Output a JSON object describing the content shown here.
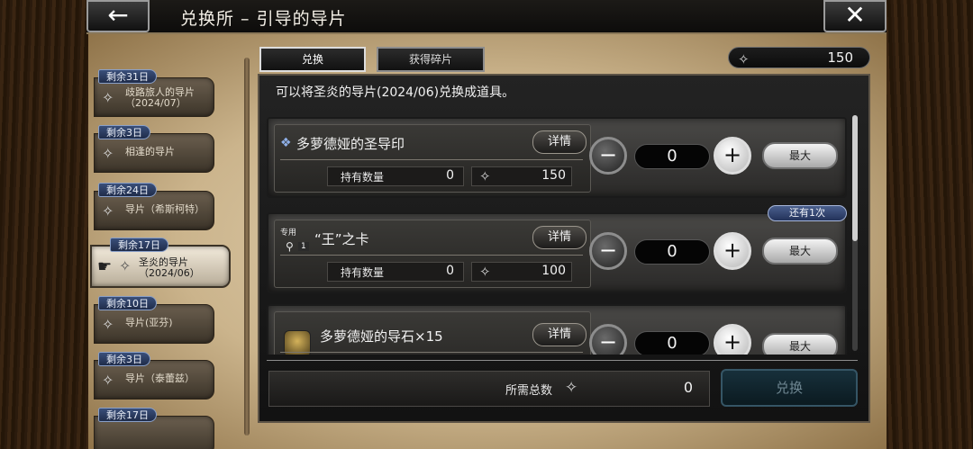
{
  "header": {
    "title": "兑换所 – 引导的导片",
    "back_icon": "←",
    "close_icon": "✕"
  },
  "sidebar": {
    "items": [
      {
        "badge": "剩余31日",
        "label": "歧路旅人的导片（2024/07）",
        "active": false
      },
      {
        "badge": "剩余3日",
        "label": "相逢的导片",
        "active": false
      },
      {
        "badge": "剩余24日",
        "label": "导片（希斯柯特）",
        "active": false
      },
      {
        "badge": "剩余17日",
        "label": "圣炎的导片（2024/06）",
        "active": true
      },
      {
        "badge": "剩余10日",
        "label": "导片(亚芬)",
        "active": false
      },
      {
        "badge": "剩余3日",
        "label": "导片（泰蕾兹）",
        "active": false
      },
      {
        "badge": "剩余17日",
        "label": "",
        "active": false
      }
    ]
  },
  "tabs": [
    {
      "label": "兑换",
      "active": true
    },
    {
      "label": "获得碎片",
      "active": false
    }
  ],
  "currency": {
    "value": "150",
    "icon": "spark-icon"
  },
  "main": {
    "description": "可以将圣炎的导片(2024/06)兑换成道具。",
    "items": [
      {
        "name": "多萝德娅的圣导印",
        "detail_label": "详情",
        "own_label": "持有数量",
        "own_value": "0",
        "cost": "150",
        "quantity": "0",
        "max_label": "最大",
        "exclusive": "",
        "limit": ""
      },
      {
        "name": "“王”之卡",
        "detail_label": "详情",
        "own_label": "持有数量",
        "own_value": "0",
        "cost": "100",
        "quantity": "0",
        "max_label": "最大",
        "exclusive": "专用",
        "bulb_num": "1",
        "limit": "还有1次"
      },
      {
        "name": "多萝德娅的导石×15",
        "detail_label": "详情",
        "own_label": "",
        "own_value": "",
        "cost": "",
        "quantity": "0",
        "max_label": "最大",
        "exclusive": "",
        "limit": ""
      }
    ]
  },
  "footer": {
    "total_label": "所需总数",
    "total_value": "0",
    "exchange_label": "兑换"
  },
  "colors": {
    "accent_blue": "#3a4f7a",
    "panel_dark": "#232323",
    "parchment": "#e3d3b3"
  }
}
